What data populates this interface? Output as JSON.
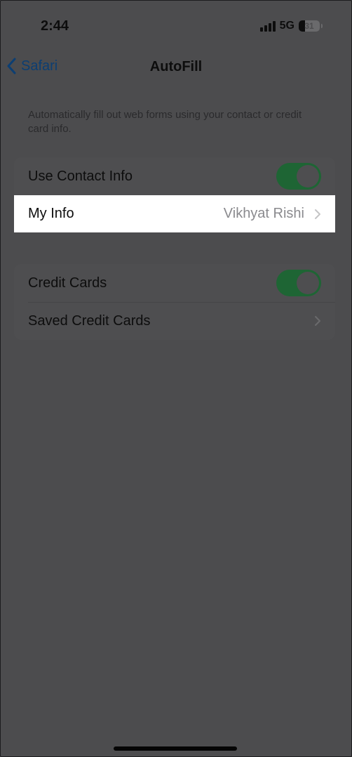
{
  "status_bar": {
    "time": "2:44",
    "network": "5G",
    "battery": "31",
    "battery_level_percent": 31
  },
  "nav": {
    "back_label": "Safari",
    "title": "AutoFill"
  },
  "description": "Automatically fill out web forms using your contact or credit card info.",
  "contact_section": {
    "use_contact_info_label": "Use Contact Info",
    "use_contact_info_on": true,
    "my_info_label": "My Info",
    "my_info_value": "Vikhyat Rishi"
  },
  "credit_section": {
    "credit_cards_label": "Credit Cards",
    "credit_cards_on": true,
    "saved_credit_cards_label": "Saved Credit Cards"
  },
  "colors": {
    "dim_background": "#4c4c4e",
    "toggle_on": "#1e6534",
    "link": "#0c3e72",
    "highlight_row": "#ffffff"
  },
  "icons": [
    "cellular-signal-icon",
    "battery-icon",
    "chevron-left-icon",
    "chevron-right-icon",
    "home-indicator"
  ]
}
